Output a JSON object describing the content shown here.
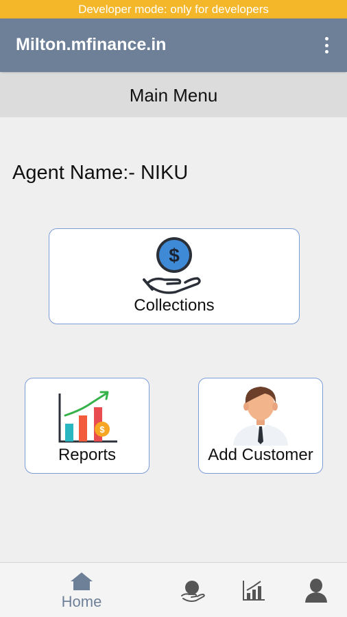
{
  "dev_banner": "Developer mode: only for developers",
  "appbar": {
    "title": "Milton.mfinance.in",
    "menu_icon": "more-vert-icon"
  },
  "menu_header": "Main Menu",
  "agent_label": "Agent Name:- NIKU",
  "tiles": {
    "collections": {
      "label": "Collections",
      "icon": "hand-dollar-icon"
    },
    "reports": {
      "label": "Reports",
      "icon": "bar-chart-growth-icon"
    },
    "add_customer": {
      "label": "Add Customer",
      "icon": "businessman-icon"
    }
  },
  "bottom_nav": {
    "home": {
      "label": "Home",
      "icon": "home-icon"
    },
    "items": [
      "collections-icon",
      "reports-icon",
      "profile-icon"
    ]
  },
  "colors": {
    "banner": "#f5b72a",
    "appbar": "#6e7f98",
    "tile_border": "#7a9bd6",
    "nav_active": "#6e7f98"
  }
}
